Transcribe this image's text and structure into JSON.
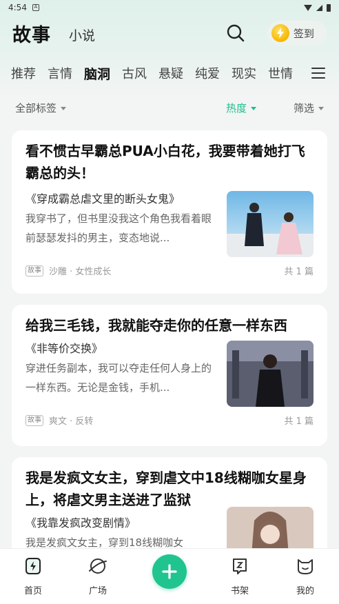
{
  "status": {
    "time": "4:54",
    "a_badge": "A"
  },
  "header": {
    "active_tab": "故事",
    "other_tab": "小说",
    "checkin_label": "签到"
  },
  "categories": [
    "推荐",
    "言情",
    "脑洞",
    "古风",
    "悬疑",
    "纯爱",
    "现实",
    "世情"
  ],
  "active_category": "脑洞",
  "filters": {
    "all_tags": "全部标签",
    "sort": "热度",
    "screen": "筛选"
  },
  "cards": [
    {
      "title": "看不惯古早霸总PUA小白花，我要带着她打飞霸总的头！",
      "book": "《穿成霸总虐文里的断头女鬼》",
      "desc": "我穿书了，但书里没我这个角色我看着眼前瑟瑟发抖的男主，变态地说...",
      "badge": "故事",
      "tags": "沙雕 · 女性成长",
      "count": "共 1 篇"
    },
    {
      "title": "给我三毛钱，我就能夺走你的任意一样东西",
      "book": "《非等价交换》",
      "desc": "穿进任务副本，我可以夺走任何人身上的一样东西。无论是金钱，手机...",
      "badge": "故事",
      "tags": "爽文 · 反转",
      "count": "共 1 篇"
    },
    {
      "title": "我是发疯文女主，穿到虐文中18线糊咖女星身上，将虐文男主送进了监狱",
      "book": "《我靠发疯改变剧情》",
      "desc": "我是发疯文女主，穿到18线糊咖女",
      "badge": "",
      "tags": "",
      "count": ""
    }
  ],
  "bottom_nav": {
    "home": "首页",
    "plaza": "广场",
    "shelf": "书架",
    "mine": "我的"
  },
  "colors": {
    "accent": "#20c48f",
    "sort_active": "#1bbf8c"
  }
}
